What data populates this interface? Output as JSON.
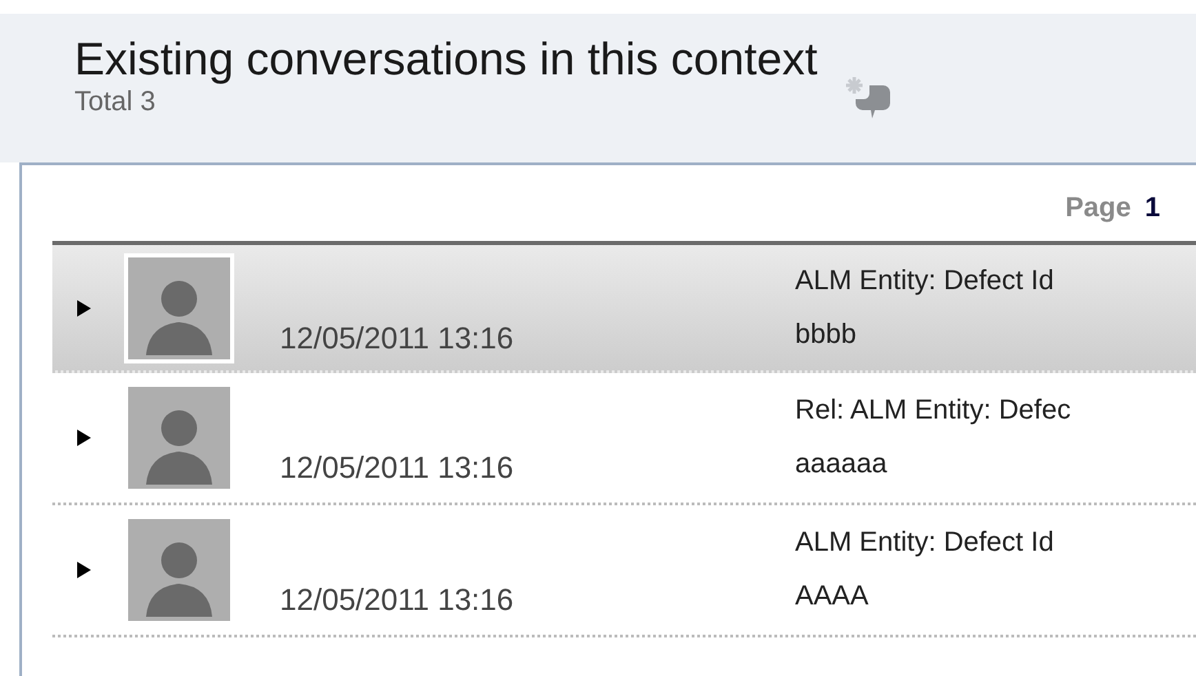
{
  "header": {
    "title": "Existing conversations in this context",
    "total": "Total 3"
  },
  "pager": {
    "label": "Page",
    "current": "1"
  },
  "conversations": [
    {
      "date": "12/05/2011 13:16",
      "title": "ALM Entity: Defect Id",
      "message": "bbbb",
      "selected": true
    },
    {
      "date": "12/05/2011 13:16",
      "title": "Rel: ALM Entity: Defec",
      "message": "aaaaaa",
      "selected": false
    },
    {
      "date": "12/05/2011 13:16",
      "title": "ALM Entity: Defect Id",
      "message": "AAAA",
      "selected": false
    }
  ]
}
